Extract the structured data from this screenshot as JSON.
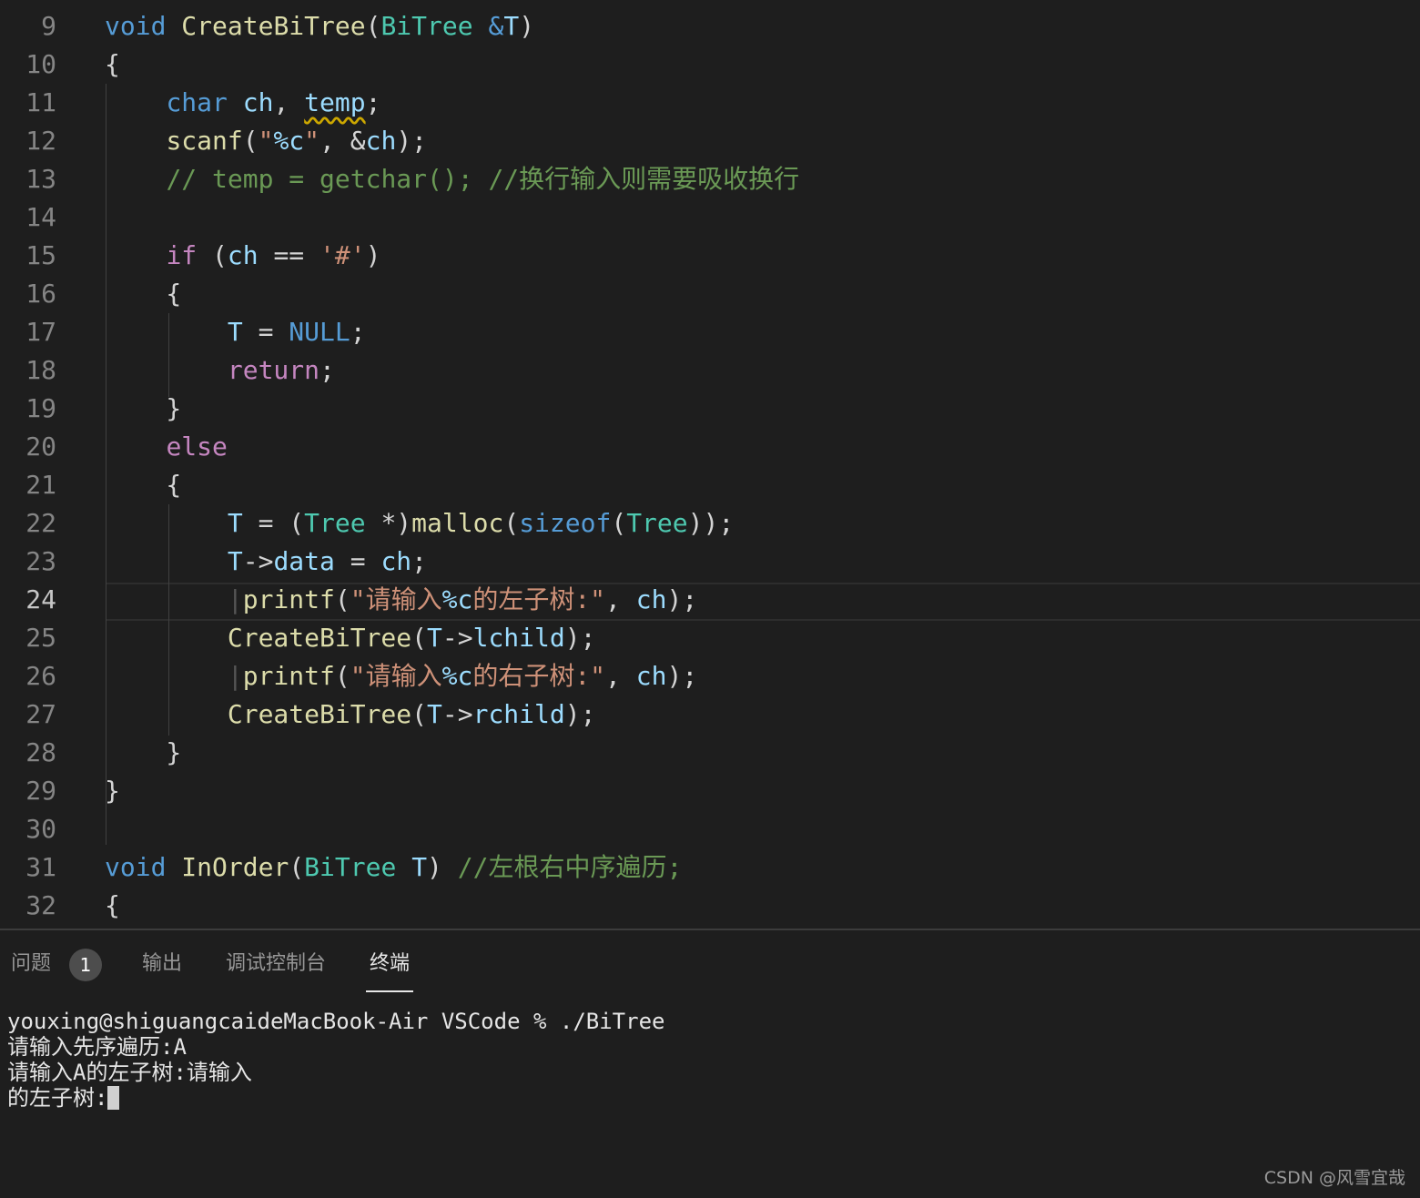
{
  "editor": {
    "line_numbers": [
      "9",
      "10",
      "11",
      "12",
      "13",
      "14",
      "15",
      "16",
      "17",
      "18",
      "19",
      "20",
      "21",
      "22",
      "23",
      "24",
      "25",
      "26",
      "27",
      "28",
      "29",
      "30",
      "31",
      "32"
    ],
    "active_line": "24"
  },
  "panel": {
    "tabs": {
      "problems": "问题",
      "output": "输出",
      "debug_console": "调试控制台",
      "terminal": "终端"
    },
    "problems_count": "1"
  },
  "terminal": {
    "lines": [
      "youxing@shiguangcaideMacBook-Air VSCode % ./BiTree",
      "请输入先序遍历:A",
      "请输入A的左子树:请输入",
      "的左子树:"
    ]
  },
  "watermark": "CSDN @风雪宜哉",
  "colors": {
    "keyword": "#569cd6",
    "control": "#c586c0",
    "function": "#dcdcaa",
    "type": "#4ec9b0",
    "string": "#ce9178",
    "comment": "#6a9955",
    "variable": "#9cdcfe"
  }
}
